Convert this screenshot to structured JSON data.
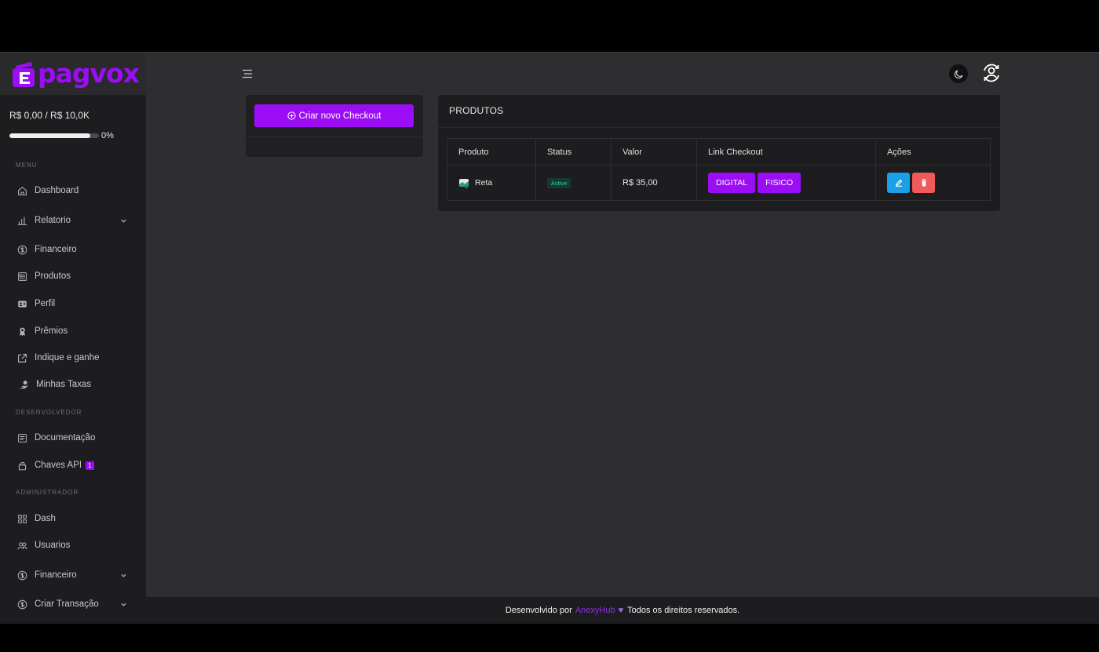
{
  "brand": {
    "logo_text": "pagvox",
    "accent": "#9b0ef5"
  },
  "sidebar": {
    "balance": "R$ 0,00 / R$ 10,0K",
    "progress_pct": "0%",
    "progress_value": 0.9,
    "sections": {
      "menu": "MENU",
      "dev": "DESENVOLVEDOR",
      "admin": "ADMINISTRADOR"
    },
    "items": [
      {
        "label": "Dashboard",
        "icon": "home-icon"
      },
      {
        "label": "Relatorio",
        "icon": "bar-chart-icon"
      },
      {
        "label": "Financeiro",
        "icon": "dollar-circle-icon"
      },
      {
        "label": "Produtos",
        "icon": "product-icon"
      },
      {
        "label": "Perfil",
        "icon": "id-card-icon"
      },
      {
        "label": "Prêmios",
        "icon": "award-icon"
      },
      {
        "label": "Indique e ganhe",
        "icon": "share-icon"
      },
      {
        "label": "Minhas Taxas",
        "icon": "hand-coin-icon"
      },
      {
        "label": "Documentação",
        "icon": "document-icon"
      },
      {
        "label": "Chaves API",
        "icon": "lock-icon",
        "badge": "1"
      },
      {
        "label": "Dash",
        "icon": "grid-icon"
      },
      {
        "label": "Usuarios",
        "icon": "users-icon"
      },
      {
        "label": "Financeiro",
        "icon": "dollar-circle-icon"
      },
      {
        "label": "Criar Transação",
        "icon": "dollar-circle-icon"
      }
    ]
  },
  "checkout": {
    "create_label": "Criar novo Checkout"
  },
  "products": {
    "title": "PRODUTOS",
    "columns": [
      "Produto",
      "Status",
      "Valor",
      "Link Checkout",
      "Ações"
    ],
    "rows": [
      {
        "name": "Reta",
        "status": "Active",
        "value": "R$ 35,00",
        "link_digital": "DIGITAL",
        "link_fisico": "FISICO"
      }
    ]
  },
  "footer": {
    "prefix": "Desenvolvido por",
    "brand": "AnexyHub",
    "heart": "♥",
    "suffix": "Todos os direitos reservados."
  }
}
